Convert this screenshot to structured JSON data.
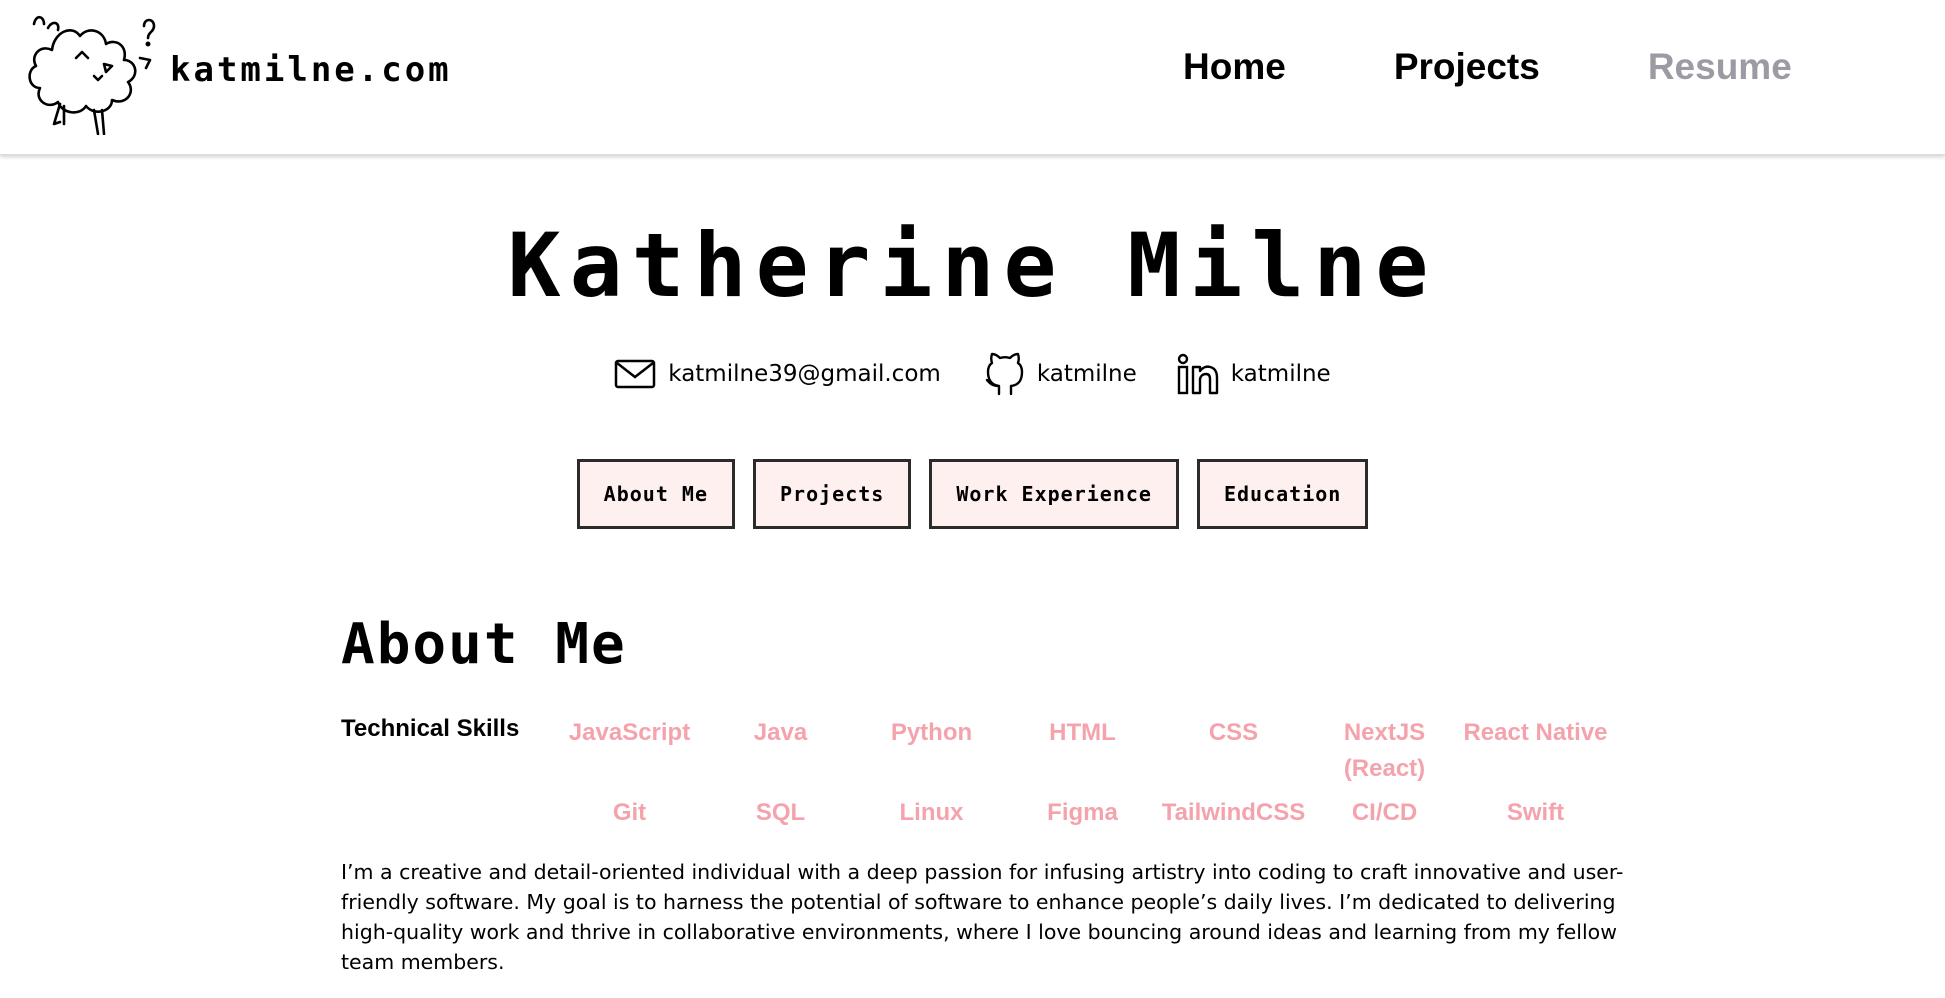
{
  "header": {
    "site_name": "katmilne.com",
    "logo_icon": "sheep-doodle-icon",
    "nav": [
      {
        "label": "Home",
        "current": false
      },
      {
        "label": "Projects",
        "current": false
      },
      {
        "label": "Resume",
        "current": true
      }
    ],
    "nav_current_color": "#9b9ba3"
  },
  "hero": {
    "name": "Katherine Milne",
    "contacts": [
      {
        "icon": "mail-icon",
        "label": "katmilne39@gmail.com"
      },
      {
        "icon": "github-icon",
        "label": "katmilne"
      },
      {
        "icon": "linkedin-icon",
        "label": "katmilne"
      }
    ],
    "sections": [
      "About Me",
      "Projects",
      "Work Experience",
      "Education"
    ],
    "section_button_bg": "#fff0f0"
  },
  "about": {
    "title": "About Me",
    "skills_label": "Technical Skills",
    "skill_color": "#f4a3ac",
    "skills": [
      "JavaScript",
      "Java",
      "Python",
      "HTML",
      "CSS",
      "NextJS (React)",
      "React Native",
      "Git",
      "SQL",
      "Linux",
      "Figma",
      "TailwindCSS",
      "CI/CD",
      "Swift"
    ],
    "text": "I’m a creative and detail-oriented individual with a deep passion for infusing artistry into coding to craft innovative and user-friendly software. My goal is to harness the potential of software to enhance people’s daily lives. I’m dedicated to delivering high-quality work and thrive in collaborative environments, where I love bouncing around ideas and learning from my fellow team members."
  }
}
